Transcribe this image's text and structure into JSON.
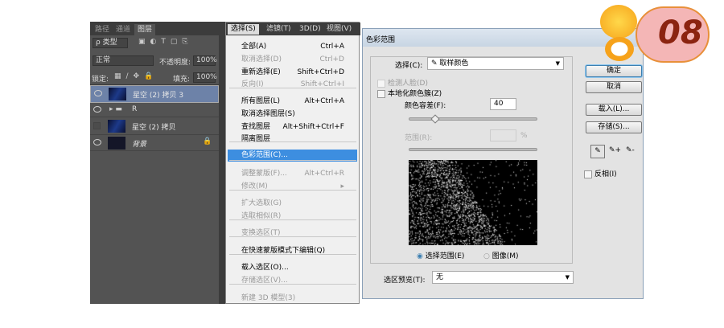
{
  "layers_panel": {
    "tabs": [
      "路径",
      "通道",
      "图层"
    ],
    "filter_label": "ρ 类型",
    "blend_mode": "正常",
    "opacity_label": "不透明度:",
    "opacity_value": "100%",
    "lock_label": "锁定:",
    "fill_label": "填充:",
    "fill_value": "100%",
    "layers": [
      {
        "name": "星空 (2) 拷贝 3",
        "visible": true,
        "selected": true
      },
      {
        "name": "R",
        "visible": true,
        "group": true
      },
      {
        "name": "星空 (2) 拷贝",
        "visible": false
      },
      {
        "name": "背景",
        "visible": true,
        "locked": true
      }
    ]
  },
  "menubar": [
    "选择(S)",
    "滤镜(T)",
    "3D(D)",
    "视图(V)"
  ],
  "select_menu": [
    {
      "label": "全部(A)",
      "shortcut": "Ctrl+A"
    },
    {
      "label": "取消选择(D)",
      "shortcut": "Ctrl+D",
      "disabled": true
    },
    {
      "label": "重新选择(E)",
      "shortcut": "Shift+Ctrl+D"
    },
    {
      "label": "反向(I)",
      "shortcut": "Shift+Ctrl+I",
      "disabled": true
    },
    {
      "label": "所有图层(L)",
      "shortcut": "Alt+Ctrl+A"
    },
    {
      "label": "取消选择图层(S)",
      "shortcut": ""
    },
    {
      "label": "查找图层",
      "shortcut": "Alt+Shift+Ctrl+F"
    },
    {
      "label": "隔离图层",
      "shortcut": ""
    },
    {
      "label": "色彩范围(C)...",
      "shortcut": "",
      "highlighted": true
    },
    {
      "label": "调整蒙版(F)...",
      "shortcut": "Alt+Ctrl+R",
      "disabled": true
    },
    {
      "label": "修改(M)",
      "shortcut": "▸",
      "disabled": true
    },
    {
      "label": "扩大选取(G)",
      "shortcut": "",
      "disabled": true
    },
    {
      "label": "选取相似(R)",
      "shortcut": "",
      "disabled": true
    },
    {
      "label": "变换选区(T)",
      "shortcut": "",
      "disabled": true
    },
    {
      "label": "在快速蒙版模式下编辑(Q)",
      "shortcut": ""
    },
    {
      "label": "载入选区(O)...",
      "shortcut": ""
    },
    {
      "label": "存储选区(V)...",
      "shortcut": "",
      "disabled": true
    },
    {
      "label": "新建 3D 模型(3)",
      "shortcut": "",
      "disabled": true
    }
  ],
  "dialog": {
    "title": "色彩范围",
    "select_label": "选择(C):",
    "select_value": "取样颜色",
    "detect_faces": "检测人脸(D)",
    "localized": "本地化颜色簇(Z)",
    "fuzziness_label": "颜色容差(F):",
    "fuzziness_value": "40",
    "fuzziness_fraction": 0.2,
    "range_label": "范围(R):",
    "range_unit": "%",
    "radio_selection": "选择范围(E)",
    "radio_image": "图像(M)",
    "preview_label": "选区预览(T):",
    "preview_value": "无",
    "ok": "确定",
    "cancel": "取消",
    "load": "载入(L)...",
    "save": "存储(S)...",
    "invert": "反相(I)"
  },
  "badge": {
    "number": "08"
  }
}
